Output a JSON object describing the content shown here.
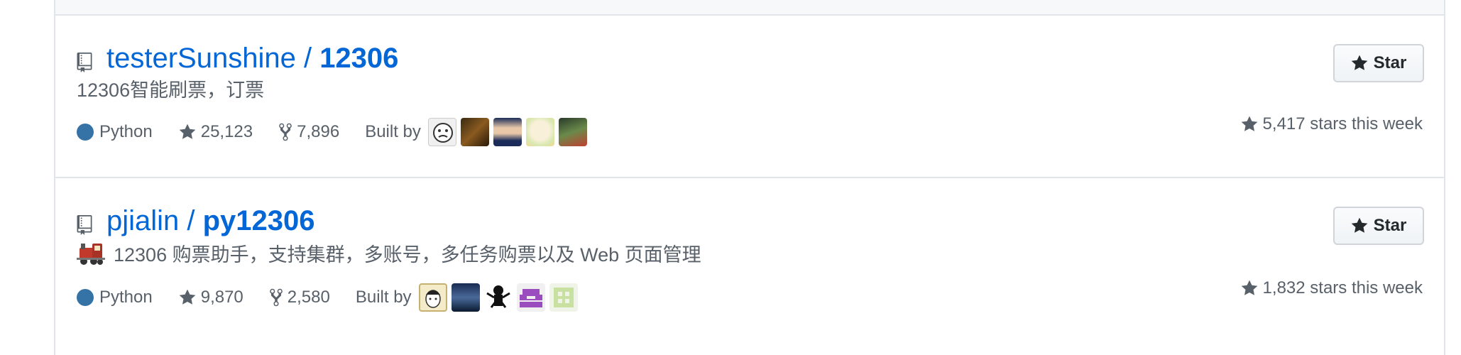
{
  "colors": {
    "link": "#0366d6",
    "muted": "#586069",
    "python": "#3572A5",
    "border": "#e1e4e8"
  },
  "repos": [
    {
      "owner": "testerSunshine / ",
      "name": "12306",
      "description": "12306智能刷票，订票",
      "description_icon": "",
      "language": "Python",
      "stars": "25,123",
      "forks": "7,896",
      "built_by_label": "Built by",
      "star_button": "Star",
      "stars_this_week": "5,417 stars this week"
    },
    {
      "owner": "pjialin / ",
      "name": "py12306",
      "description": "12306 购票助手，支持集群，多账号，多任务购票以及 Web 页面管理",
      "description_icon": "train-emoji-icon",
      "language": "Python",
      "stars": "9,870",
      "forks": "2,580",
      "built_by_label": "Built by",
      "star_button": "Star",
      "stars_this_week": "1,832 stars this week"
    }
  ]
}
